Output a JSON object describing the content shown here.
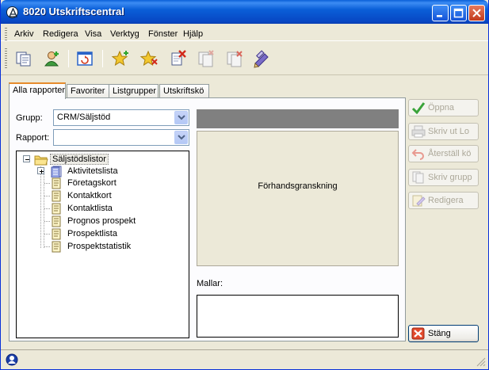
{
  "window": {
    "title": "8020 Utskriftscentral"
  },
  "menu": [
    "Arkiv",
    "Redigera",
    "Visa",
    "Verktyg",
    "Fönster",
    "Hjälp"
  ],
  "tabs": [
    {
      "label": "Alla rapporter",
      "active": true
    },
    {
      "label": "Favoriter",
      "active": false
    },
    {
      "label": "Listgrupper",
      "active": false
    },
    {
      "label": "Utskriftskö",
      "active": false
    }
  ],
  "form": {
    "grupp_label": "Grupp:",
    "grupp_value": "CRM/Säljstöd",
    "rapport_label": "Rapport:",
    "rapport_value": ""
  },
  "tree": {
    "root": "Säljstödslistor",
    "items": [
      "Aktivitetslista",
      "Företagskort",
      "Kontaktkort",
      "Kontaktlista",
      "Prognos prospekt",
      "Prospektlista",
      "Prospektstatistik"
    ]
  },
  "preview": {
    "text": "Förhandsgranskning"
  },
  "mallar": {
    "label": "Mallar:"
  },
  "side_buttons": {
    "open": "Öppna",
    "print_file": "Skriv ut Lo",
    "reset_queue": "Återställ kö",
    "print_group": "Skriv grupp",
    "edit": "Redigera",
    "close": "Stäng"
  },
  "colors": {
    "title_bar": "#0a5fd8",
    "close_button": "#c23a1c",
    "active_tab_accent": "#e68b2c",
    "window_bg": "#ece9d8"
  }
}
